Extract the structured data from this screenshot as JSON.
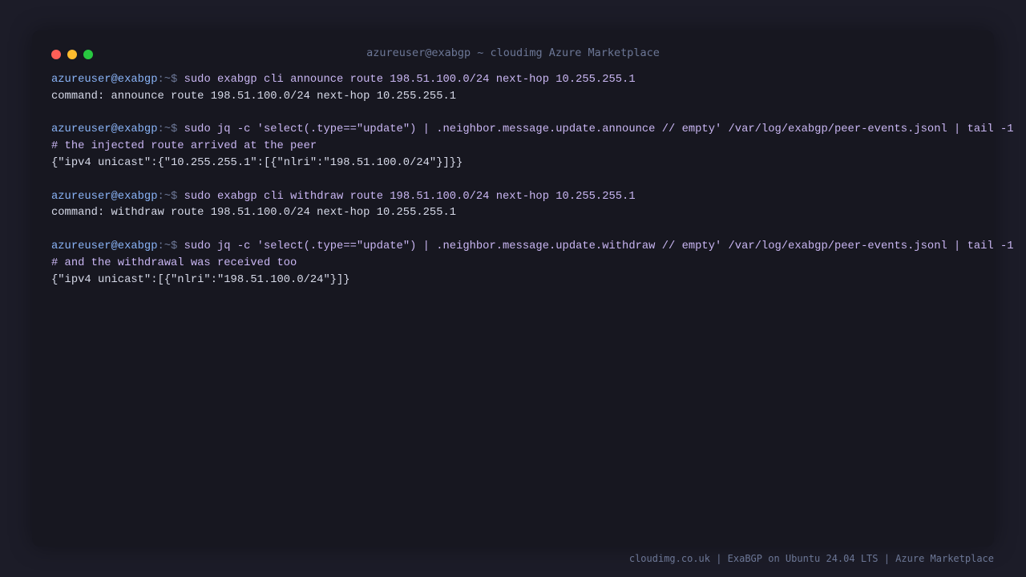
{
  "window": {
    "title": "azureuser@exabgp ~ cloudimg Azure Marketplace"
  },
  "terminal": {
    "lines": [
      {
        "type": "cmd",
        "user": "azureuser@exabgp",
        "path": ":~$ ",
        "text": "sudo exabgp cli announce route 198.51.100.0/24 next-hop 10.255.255.1"
      },
      {
        "type": "out",
        "text": "command: announce route 198.51.100.0/24 next-hop 10.255.255.1"
      },
      {
        "type": "blank"
      },
      {
        "type": "cmd",
        "user": "azureuser@exabgp",
        "path": ":~$ ",
        "text": "sudo jq -c 'select(.type==\"update\") | .neighbor.message.update.announce // empty' /var/log/exabgp/peer-events.jsonl | tail -1"
      },
      {
        "type": "comment",
        "text": "# the injected route arrived at the peer"
      },
      {
        "type": "out",
        "text": "{\"ipv4 unicast\":{\"10.255.255.1\":[{\"nlri\":\"198.51.100.0/24\"}]}}"
      },
      {
        "type": "blank"
      },
      {
        "type": "cmd",
        "user": "azureuser@exabgp",
        "path": ":~$ ",
        "text": "sudo exabgp cli withdraw route 198.51.100.0/24 next-hop 10.255.255.1"
      },
      {
        "type": "out",
        "text": "command: withdraw route 198.51.100.0/24 next-hop 10.255.255.1"
      },
      {
        "type": "blank"
      },
      {
        "type": "cmd",
        "user": "azureuser@exabgp",
        "path": ":~$ ",
        "text": "sudo jq -c 'select(.type==\"update\") | .neighbor.message.update.withdraw // empty' /var/log/exabgp/peer-events.jsonl | tail -1"
      },
      {
        "type": "comment",
        "text": "# and the withdrawal was received too"
      },
      {
        "type": "out",
        "text": "{\"ipv4 unicast\":[{\"nlri\":\"198.51.100.0/24\"}]}"
      }
    ]
  },
  "footer": {
    "text": "cloudimg.co.uk | ExaBGP on Ubuntu 24.04 LTS | Azure Marketplace"
  },
  "colors": {
    "background": "#1c1c28",
    "window": "#171720",
    "prompt_user": "#8ab4f8",
    "command": "#c9b6f2",
    "output": "#d6d9e8",
    "muted": "#6c7796",
    "close": "#ff5f57",
    "minimize": "#febc2e",
    "maximize": "#28c840"
  }
}
